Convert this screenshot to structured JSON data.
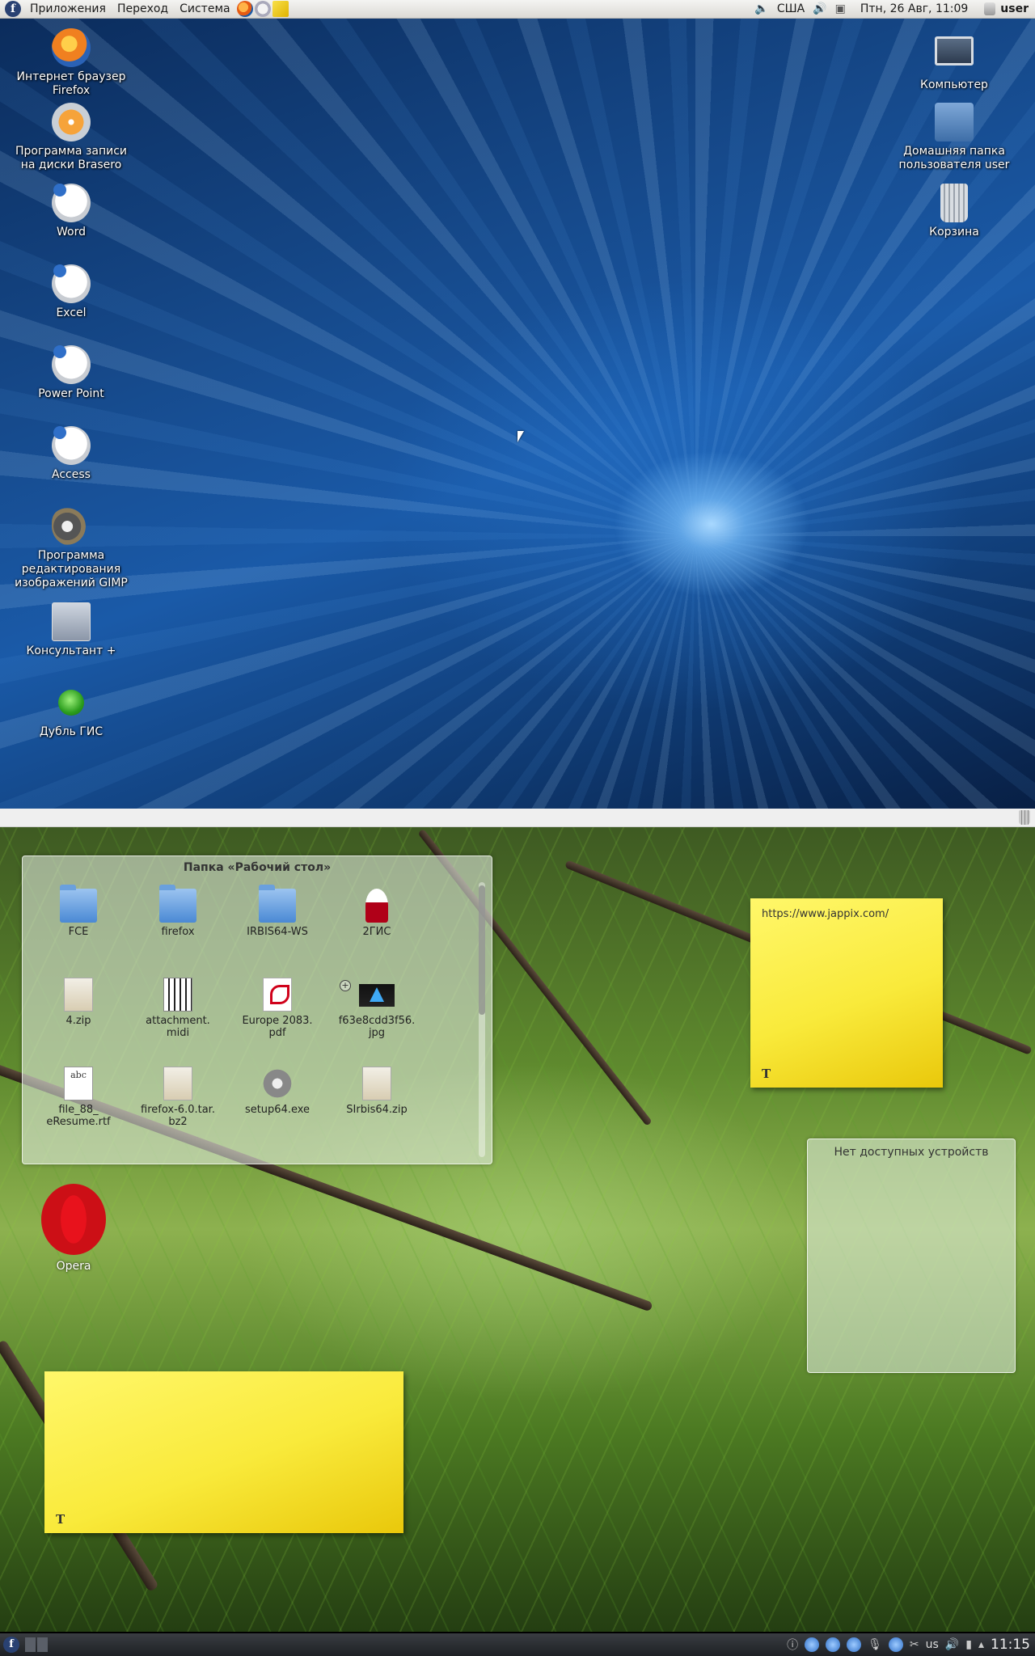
{
  "top_panel": {
    "menus": [
      "Приложения",
      "Переход",
      "Система"
    ],
    "keyboard_layout": "США",
    "clock": "Птн, 26 Авг, 11:09",
    "user": "user"
  },
  "top_desktop": {
    "left_icons": [
      {
        "label": "Интернет браузер\nFirefox",
        "icon": "firefox-icon"
      },
      {
        "label": "Программа записи\nна диски Brasero",
        "icon": "brasero-icon"
      },
      {
        "label": "Word",
        "icon": "word-icon"
      },
      {
        "label": "Excel",
        "icon": "excel-icon"
      },
      {
        "label": "Power Point",
        "icon": "powerpoint-icon"
      },
      {
        "label": "Access",
        "icon": "access-icon"
      },
      {
        "label": "Программа\nредактирования\nизображений GIMP",
        "icon": "gimp-icon"
      },
      {
        "label": "Консультант +",
        "icon": "consultant-icon"
      },
      {
        "label": "Дубль ГИС",
        "icon": "dublgis-icon"
      }
    ],
    "right_icons": [
      {
        "label": "Компьютер",
        "icon": "computer-icon"
      },
      {
        "label": "Домашняя папка\nпользователя user",
        "icon": "home-folder-icon"
      },
      {
        "label": "Корзина",
        "icon": "trash-icon"
      }
    ]
  },
  "folder_view": {
    "title": "Папка «Рабочий стол»",
    "items": [
      {
        "label": "FCE",
        "type": "folder"
      },
      {
        "label": "firefox",
        "type": "folder"
      },
      {
        "label": "IRBIS64-WS",
        "type": "folder"
      },
      {
        "label": "2ГИС",
        "type": "app"
      },
      {
        "label": "4.zip",
        "type": "zip"
      },
      {
        "label": "attachment.\nmidi",
        "type": "midi"
      },
      {
        "label": "Europe 2083.\npdf",
        "type": "pdf"
      },
      {
        "label": "f63e8cdd3f56.\njpg",
        "type": "jpg"
      },
      {
        "label": "file_88_\neResume.rtf",
        "type": "rtf"
      },
      {
        "label": "firefox-6.0.tar.\nbz2",
        "type": "zip"
      },
      {
        "label": "setup64.exe",
        "type": "exe"
      },
      {
        "label": "SIrbis64.zip",
        "type": "zip"
      }
    ],
    "plus_badge": "+"
  },
  "sticky_notes": [
    {
      "text": "https://www.jappix.com/",
      "tool": "T"
    },
    {
      "text": "",
      "tool": "T"
    }
  ],
  "devices_widget": {
    "title": "Нет доступных устройств"
  },
  "opera": {
    "label": "Opera"
  },
  "kde_panel": {
    "layout": "us",
    "clock": "11:15"
  }
}
